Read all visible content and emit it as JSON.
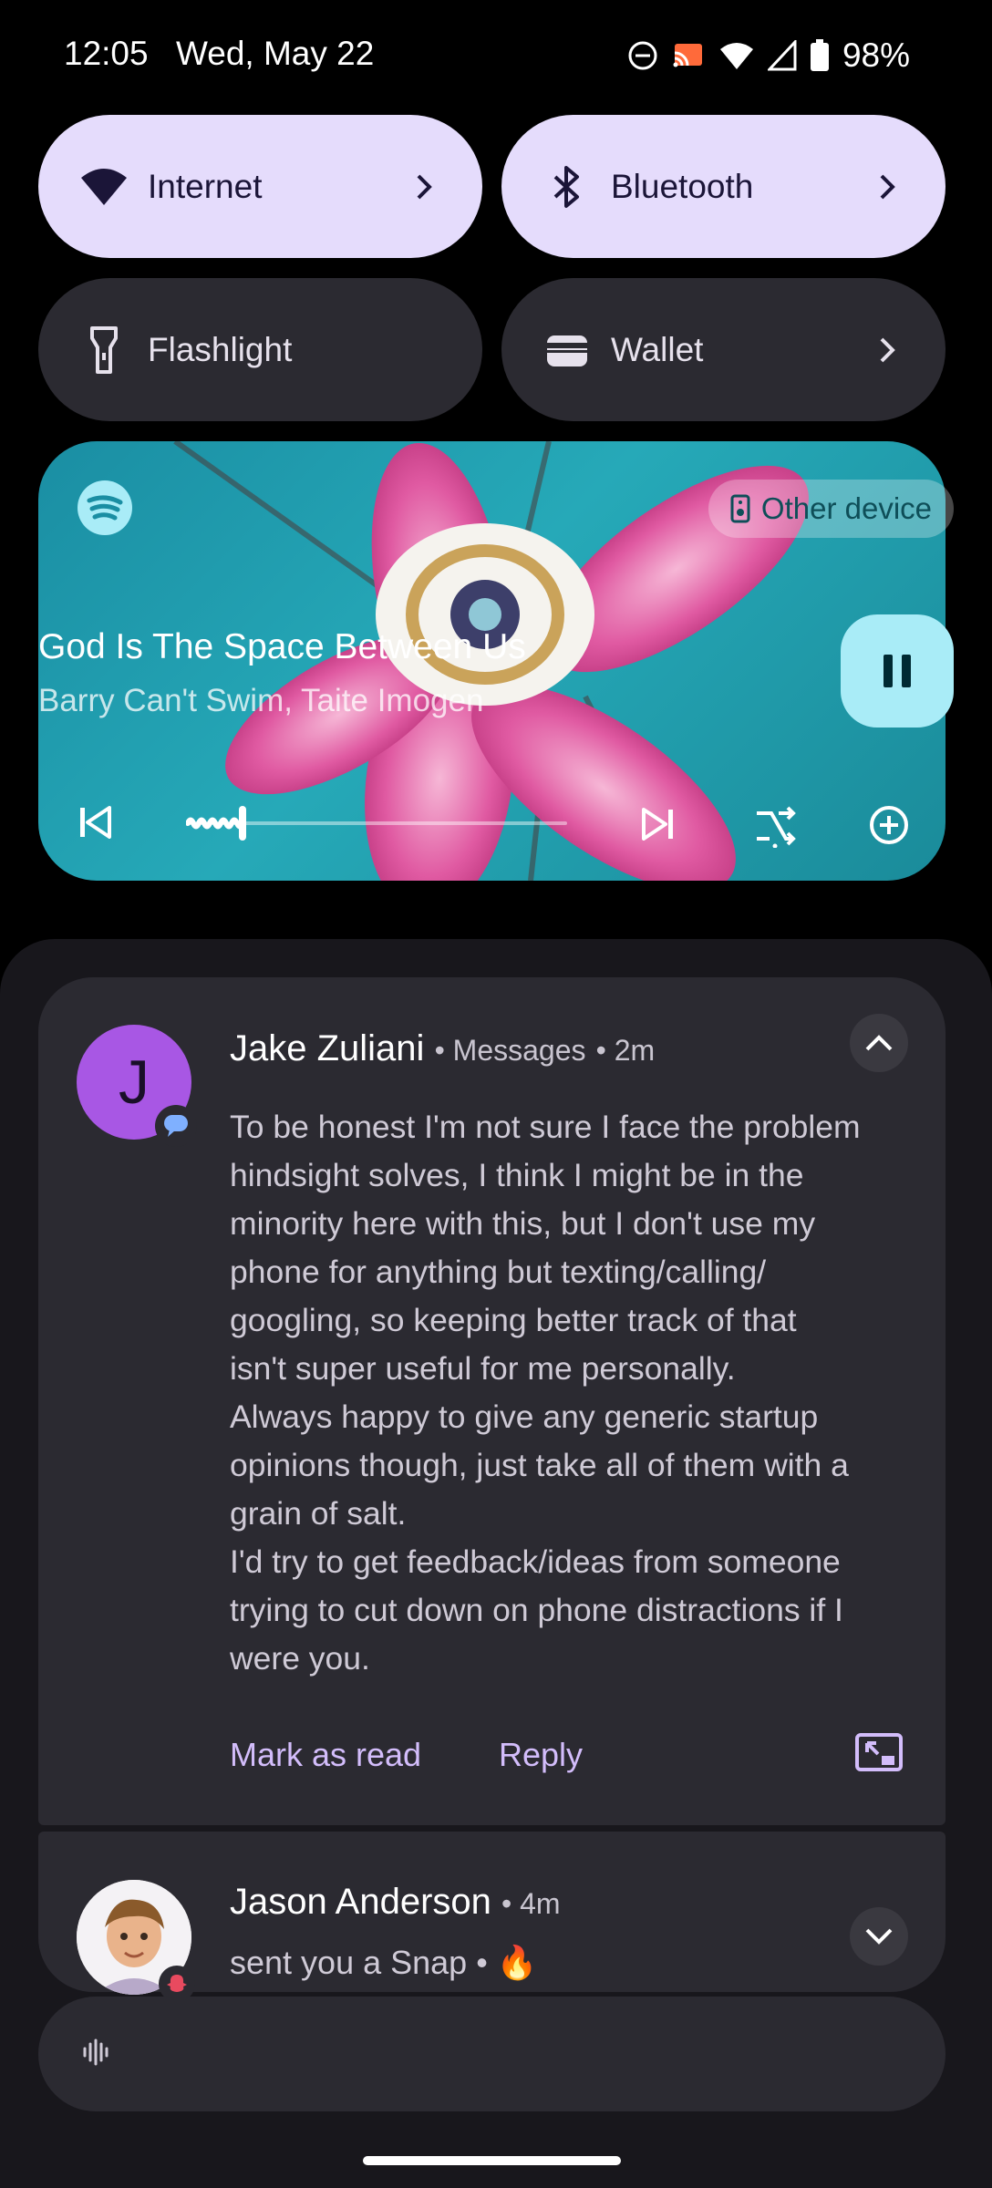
{
  "status_bar": {
    "time": "12:05",
    "date": "Wed, May 22",
    "battery": "98%",
    "icons": [
      "do-not-disturb-icon",
      "cast-icon",
      "wifi-icon",
      "cell-signal-icon",
      "battery-icon"
    ]
  },
  "quick_settings": {
    "tiles": [
      {
        "label": "Internet",
        "icon": "wifi-icon",
        "active": true,
        "has_chevron": true
      },
      {
        "label": "Bluetooth",
        "icon": "bluetooth-icon",
        "active": true,
        "has_chevron": true
      },
      {
        "label": "Flashlight",
        "icon": "flashlight-icon",
        "active": false,
        "has_chevron": false
      },
      {
        "label": "Wallet",
        "icon": "wallet-icon",
        "active": false,
        "has_chevron": true
      }
    ]
  },
  "media": {
    "app_icon": "spotify-icon",
    "output_chip": "Other device",
    "title": "God Is The Space Between Us",
    "artist": "Barry Can't Swim, Taite Imogen",
    "progress": 0.15,
    "controls": [
      "previous-icon",
      "next-icon",
      "shuffle-icon",
      "add-icon"
    ],
    "accent": "#a9ecf7"
  },
  "notifications": [
    {
      "sender": "Jake Zuliani",
      "app": "Messages",
      "time": "2m",
      "avatar_letter": "J",
      "body": "To be honest I'm not sure I face the problem\nhindsight solves, I think I might be in the\nminority here with this, but I don't use my\nphone for anything but texting/calling/\ngoogling, so keeping better track of that\nisn't super useful for me personally.\nAlways happy to give any generic startup\nopinions though, just take all of them with a\ngrain of salt.\nI'd try to get feedback/ideas from someone\ntrying to cut down on phone distractions if I\nwere you.",
      "actions": [
        "Mark as read",
        "Reply"
      ],
      "expanded": true
    },
    {
      "sender": "Jason Anderson",
      "time": "4m",
      "body": "sent you a Snap • 🔥",
      "expanded": false
    }
  ],
  "colors": {
    "tile_active": "#e5dcfc",
    "tile_inactive": "#2b2a31",
    "action_text": "#d3bdfb",
    "avatar_j": "#a857e4"
  }
}
